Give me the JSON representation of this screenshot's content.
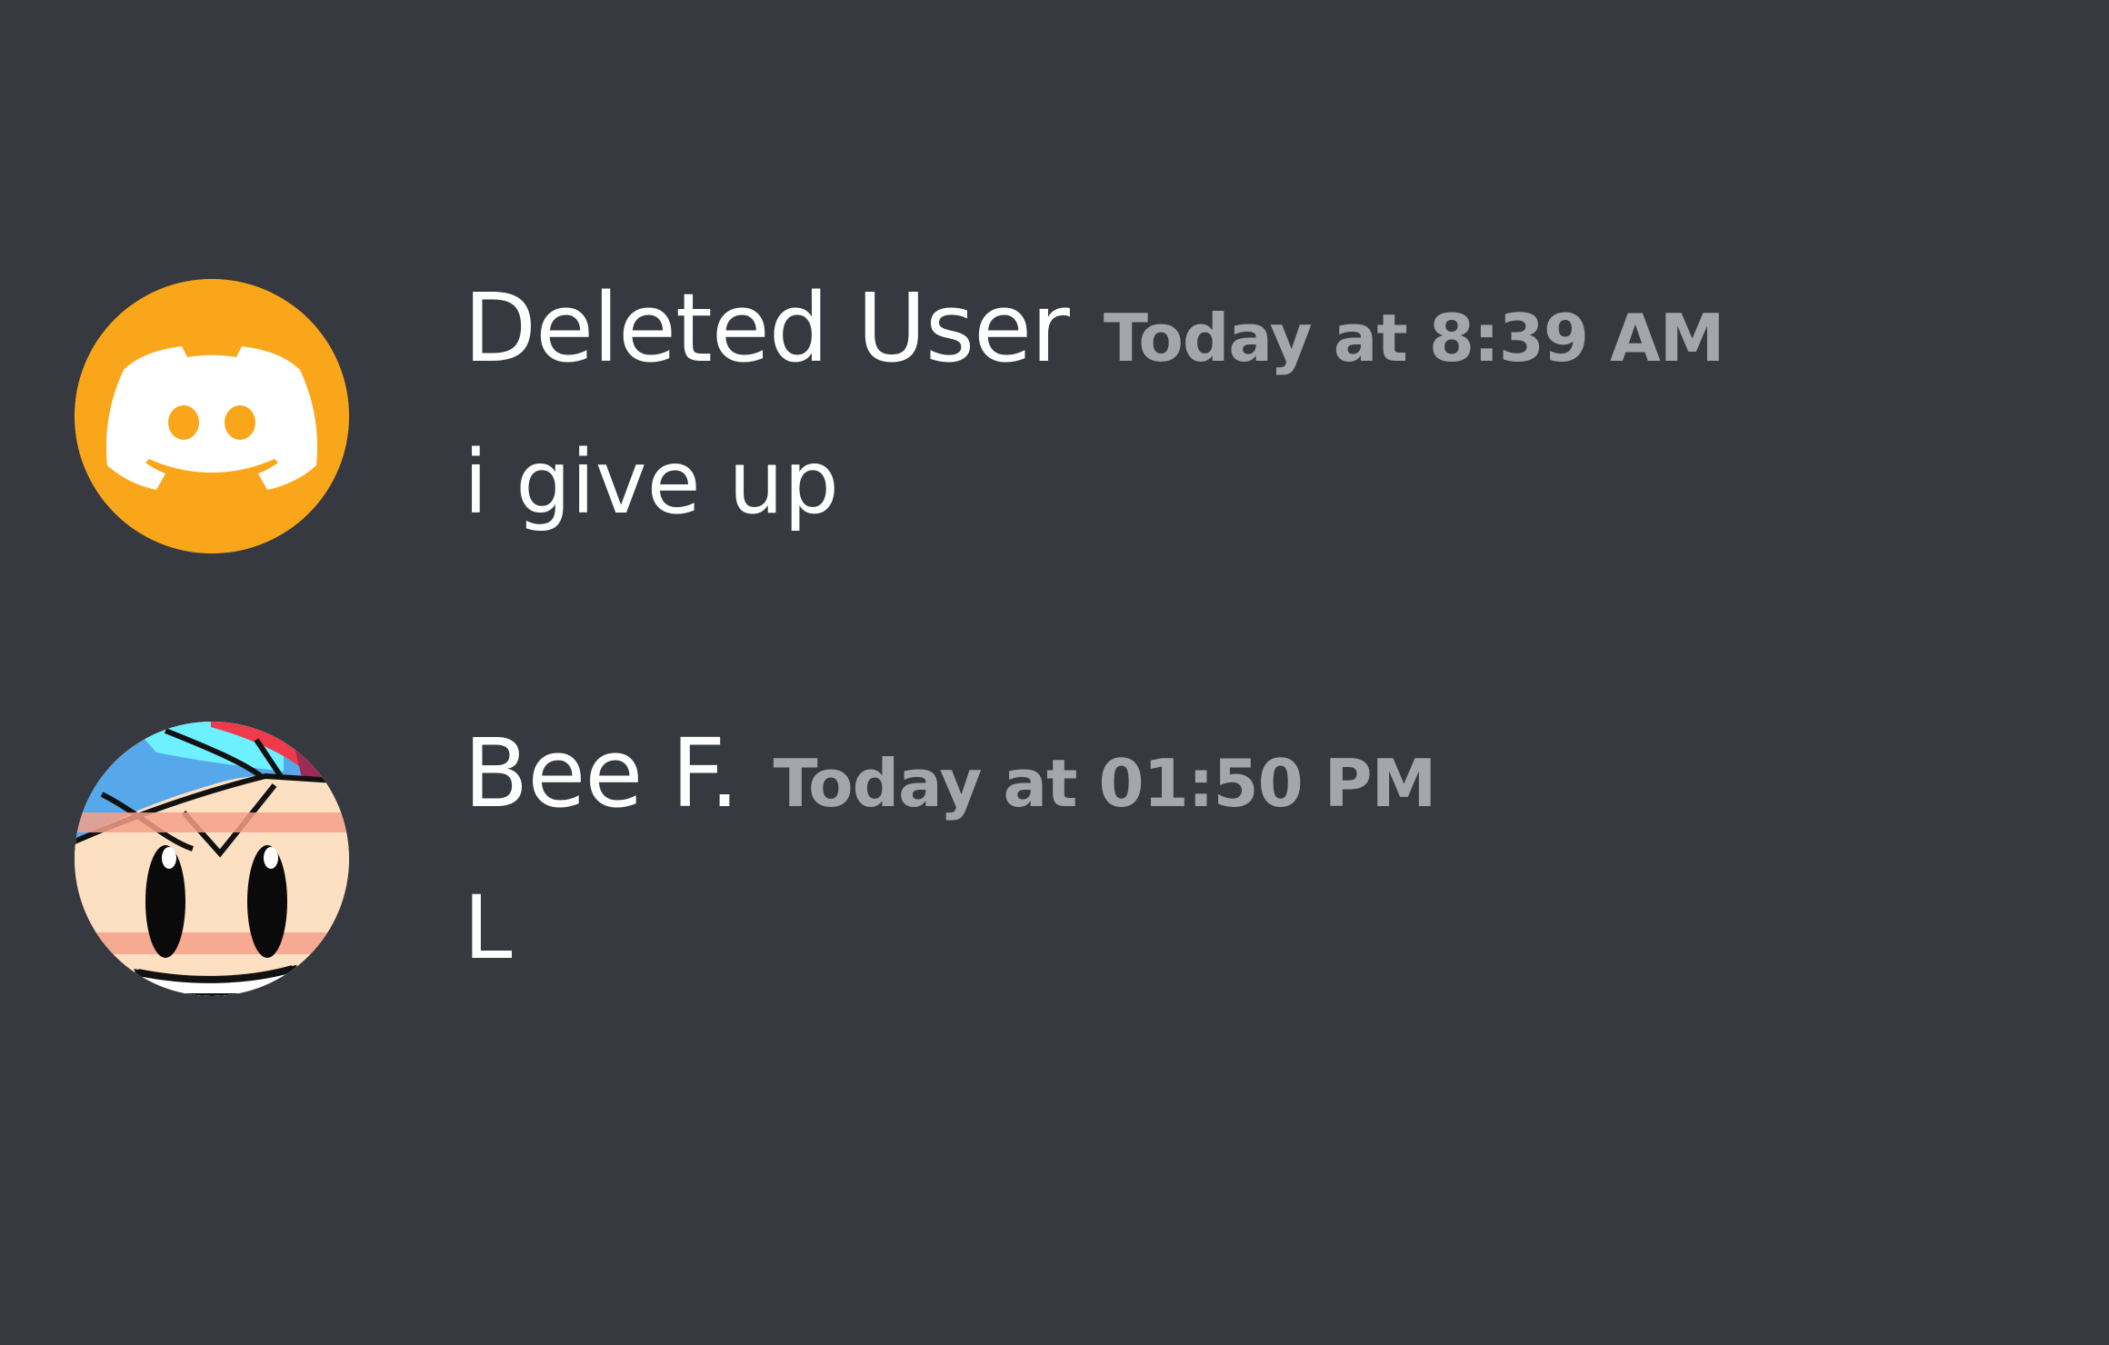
{
  "messages": [
    {
      "username": "Deleted User",
      "timestamp": "Today at 8:39 AM",
      "content": "i give up",
      "avatar_icon": "discord-logo-icon",
      "avatar_color": "#faa61a"
    },
    {
      "username": "Bee F.",
      "timestamp": "Today at 01:50 PM",
      "content": "L",
      "avatar_icon": "cartoon-character-face"
    }
  ],
  "colors": {
    "background": "#36393f",
    "username": "#ffffff",
    "timestamp": "#a3a6aa",
    "content": "#ffffff"
  }
}
